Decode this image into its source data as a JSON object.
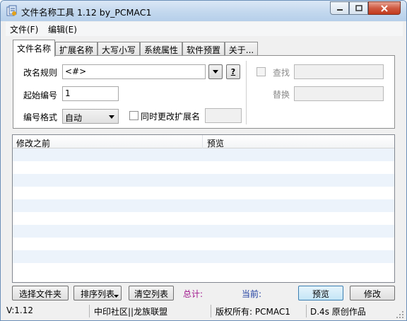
{
  "window": {
    "title": "文件名称工具 1.12  by_PCMAC1"
  },
  "menu": {
    "items": [
      "文件(F)",
      "编辑(E)"
    ]
  },
  "tabs": [
    "文件名称",
    "扩展名称",
    "大写小写",
    "系统属性",
    "软件预置",
    "关于..."
  ],
  "form": {
    "rename_rule_label": "改名规则",
    "rename_rule_value": "<#>",
    "help_button_label": "?",
    "start_number_label": "起始编号",
    "start_number_value": "1",
    "number_format_label": "编号格式",
    "number_format_value": "自动",
    "change_ext_label": "同时更改扩展名",
    "change_ext_value": "",
    "find_label": "查找",
    "find_value": "",
    "replace_label": "替换",
    "replace_value": ""
  },
  "list": {
    "columns": [
      "修改之前",
      "预览"
    ],
    "rows": []
  },
  "buttons": {
    "select_files": "选择文件夹",
    "sort_list": "排序列表",
    "clear_list": "清空列表",
    "preview": "预览",
    "modify": "修改"
  },
  "stats": {
    "total_label": "总计:",
    "current_label": "当前:",
    "total_color": "#a0148c",
    "current_color": "#1a3a9e"
  },
  "status": {
    "version": "V:1.12",
    "community": "中印社区||龙族联盟",
    "copyright": "版权所有: PCMAC1",
    "credit": "D.4s 原创作品"
  }
}
